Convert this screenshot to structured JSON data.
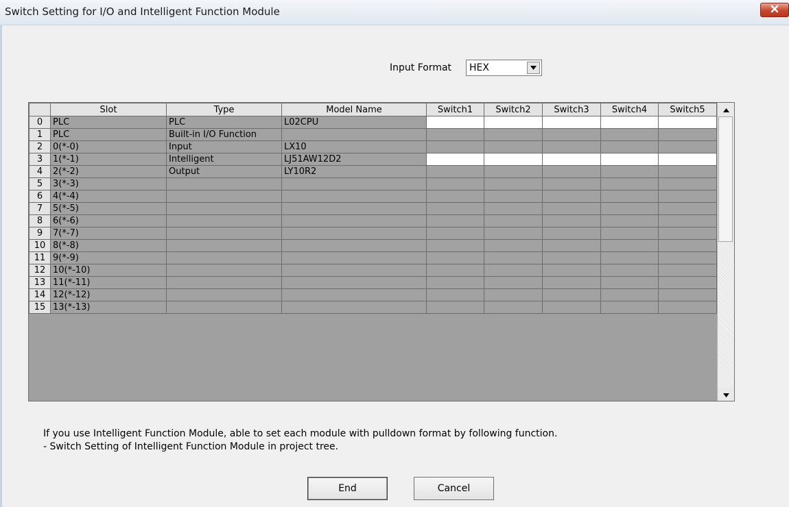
{
  "window": {
    "title": "Switch Setting for I/O and Intelligent Function Module",
    "close_icon": "close-icon"
  },
  "input_format": {
    "label": "Input Format",
    "value": "HEX"
  },
  "grid": {
    "headers": [
      "Slot",
      "Type",
      "Model Name",
      "Switch1",
      "Switch2",
      "Switch3",
      "Switch4",
      "Switch5"
    ],
    "rows": [
      {
        "num": "0",
        "slot": "PLC",
        "type": "PLC",
        "model": "L02CPU",
        "editable": true
      },
      {
        "num": "1",
        "slot": "PLC",
        "type": "Built-in I/O Function",
        "model": "",
        "editable": false
      },
      {
        "num": "2",
        "slot": "0(*-0)",
        "type": "Input",
        "model": "LX10",
        "editable": false
      },
      {
        "num": "3",
        "slot": "1(*-1)",
        "type": "Intelligent",
        "model": "LJ51AW12D2",
        "editable": true
      },
      {
        "num": "4",
        "slot": "2(*-2)",
        "type": "Output",
        "model": "LY10R2",
        "editable": false
      },
      {
        "num": "5",
        "slot": "3(*-3)",
        "type": "",
        "model": "",
        "editable": false
      },
      {
        "num": "6",
        "slot": "4(*-4)",
        "type": "",
        "model": "",
        "editable": false
      },
      {
        "num": "7",
        "slot": "5(*-5)",
        "type": "",
        "model": "",
        "editable": false
      },
      {
        "num": "8",
        "slot": "6(*-6)",
        "type": "",
        "model": "",
        "editable": false
      },
      {
        "num": "9",
        "slot": "7(*-7)",
        "type": "",
        "model": "",
        "editable": false
      },
      {
        "num": "10",
        "slot": "8(*-8)",
        "type": "",
        "model": "",
        "editable": false
      },
      {
        "num": "11",
        "slot": "9(*-9)",
        "type": "",
        "model": "",
        "editable": false
      },
      {
        "num": "12",
        "slot": "10(*-10)",
        "type": "",
        "model": "",
        "editable": false
      },
      {
        "num": "13",
        "slot": "11(*-11)",
        "type": "",
        "model": "",
        "editable": false
      },
      {
        "num": "14",
        "slot": "12(*-12)",
        "type": "",
        "model": "",
        "editable": false
      },
      {
        "num": "15",
        "slot": "13(*-13)",
        "type": "",
        "model": "",
        "editable": false
      }
    ]
  },
  "info": {
    "line1": "If you use Intelligent Function Module, able to set each module with pulldown format by following function.",
    "line2": "- Switch Setting of Intelligent Function Module in project tree."
  },
  "buttons": {
    "end": "End",
    "cancel": "Cancel"
  }
}
